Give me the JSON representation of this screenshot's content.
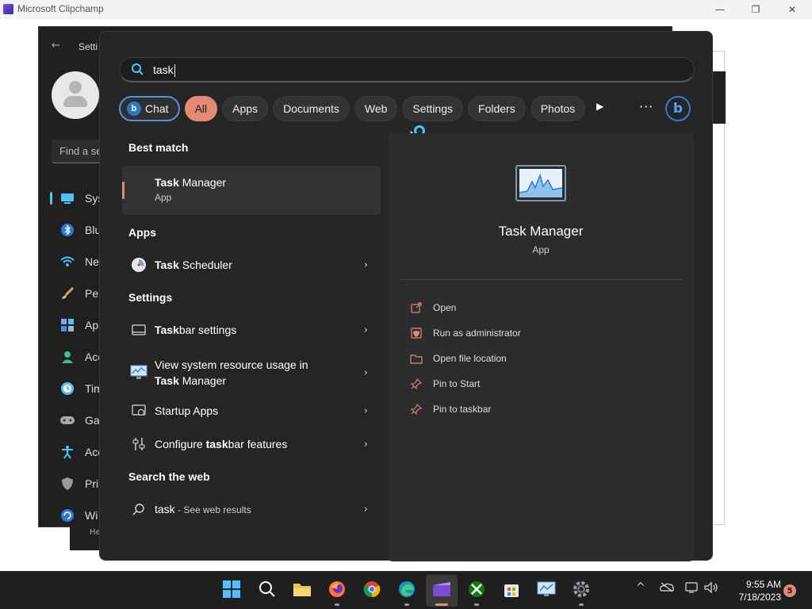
{
  "host": {
    "title": "Microsoft Clipchamp",
    "minimize": "—",
    "restore": "❐",
    "close": "✕"
  },
  "settings_window": {
    "title": "Setti",
    "back": "←",
    "find_placeholder": "Find a se",
    "nav": [
      {
        "label": "Sys",
        "icon": "system-icon"
      },
      {
        "label": "Blu",
        "icon": "bluetooth-icon"
      },
      {
        "label": "Ne",
        "icon": "wifi-icon"
      },
      {
        "label": "Per",
        "icon": "brush-icon"
      },
      {
        "label": "Ap",
        "icon": "apps-icon"
      },
      {
        "label": "Acc",
        "icon": "account-icon"
      },
      {
        "label": "Tim",
        "icon": "time-icon"
      },
      {
        "label": "Ga",
        "icon": "gaming-icon"
      },
      {
        "label": "Acc",
        "icon": "accessibility-icon"
      },
      {
        "label": "Pri",
        "icon": "shield-icon"
      },
      {
        "label": "Wi",
        "icon": "update-icon"
      }
    ],
    "footer": "He"
  },
  "search": {
    "query": "task",
    "filters": [
      "Chat",
      "All",
      "Apps",
      "Documents",
      "Web",
      "Settings",
      "Folders",
      "Photos"
    ],
    "bing_letter": "b",
    "more": "···",
    "play": "▶"
  },
  "results": {
    "best_match_heading": "Best match",
    "best_match": {
      "bold": "Task",
      "rest": " Manager",
      "type": "App"
    },
    "apps_heading": "Apps",
    "apps": [
      {
        "bold": "Task",
        "rest": " Scheduler"
      }
    ],
    "settings_heading": "Settings",
    "settings": [
      {
        "pre": "",
        "bold": "Task",
        "rest": "bar settings"
      },
      {
        "line1": "View system resource usage in",
        "bold": "Task",
        "rest": " Manager"
      },
      {
        "pre": "Startup Apps",
        "bold": "",
        "rest": ""
      },
      {
        "pre": "Configure ",
        "bold": "task",
        "rest": "bar features"
      }
    ],
    "web_heading": "Search the web",
    "web": {
      "query": "task",
      "suffix": " - See web results"
    }
  },
  "details": {
    "name": "Task Manager",
    "type": "App",
    "actions": [
      {
        "label": "Open",
        "icon": "open-icon"
      },
      {
        "label": "Run as administrator",
        "icon": "shield-admin-icon"
      },
      {
        "label": "Open file location",
        "icon": "folder-icon"
      },
      {
        "label": "Pin to Start",
        "icon": "pin-icon"
      },
      {
        "label": "Pin to taskbar",
        "icon": "pin-icon"
      }
    ]
  },
  "taskbar": {
    "time": "9:55 AM",
    "date": "7/18/2023",
    "notifications": "5",
    "chevron": "^"
  },
  "colors": {
    "accent": "#e38a74",
    "bing": "#2f7fd6",
    "panel": "#252525"
  }
}
